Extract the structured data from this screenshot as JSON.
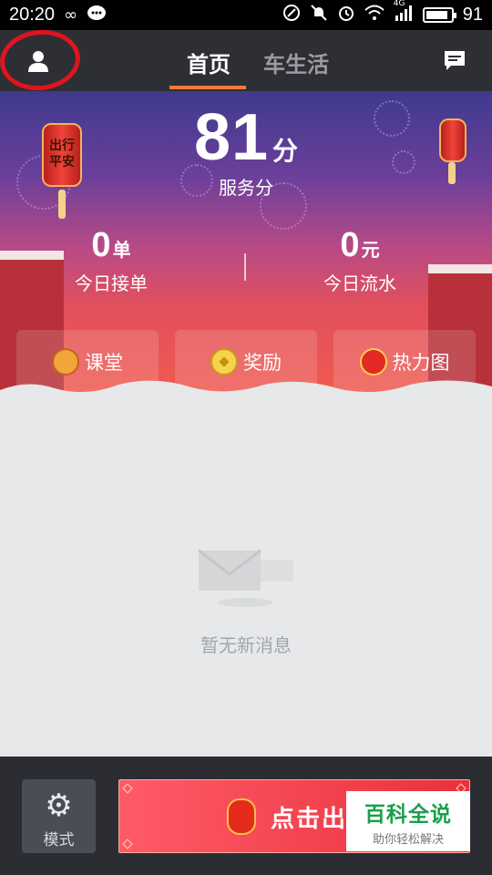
{
  "status_bar": {
    "time": "20:20",
    "network": "4G",
    "battery": "91",
    "battery_level": 0.91,
    "icons": [
      "infinity-icon",
      "chat-bubble-icon",
      "nfc-icon",
      "mute-icon",
      "alarm-icon",
      "wifi-icon",
      "signal-icon",
      "battery-icon"
    ]
  },
  "top_nav": {
    "tabs": [
      {
        "label": "首页",
        "active": true
      },
      {
        "label": "车生活",
        "active": false
      }
    ],
    "accent_color": "#f07a3c",
    "annotation_color": "#e0141e"
  },
  "hero": {
    "lantern_text": "出行平安",
    "score": "81",
    "score_unit": "分",
    "score_label": "服务分",
    "stats": [
      {
        "value": "0",
        "unit": "单",
        "label": "今日接单"
      },
      {
        "value": "0",
        "unit": "元",
        "label": "今日流水"
      }
    ],
    "features": [
      {
        "label": "课堂",
        "icon": "monkey-icon"
      },
      {
        "label": "奖励",
        "icon": "coin-icon"
      },
      {
        "label": "热力图",
        "icon": "heatmap-icon"
      }
    ]
  },
  "empty_state": {
    "text": "暂无新消息",
    "icon": "envelope-icon"
  },
  "bottom_bar": {
    "mode_label": "模式",
    "go_label": "点击出车",
    "go_visible": "点击出"
  },
  "watermark": {
    "title": "百科全说",
    "subtitle": "助你轻松解决"
  }
}
